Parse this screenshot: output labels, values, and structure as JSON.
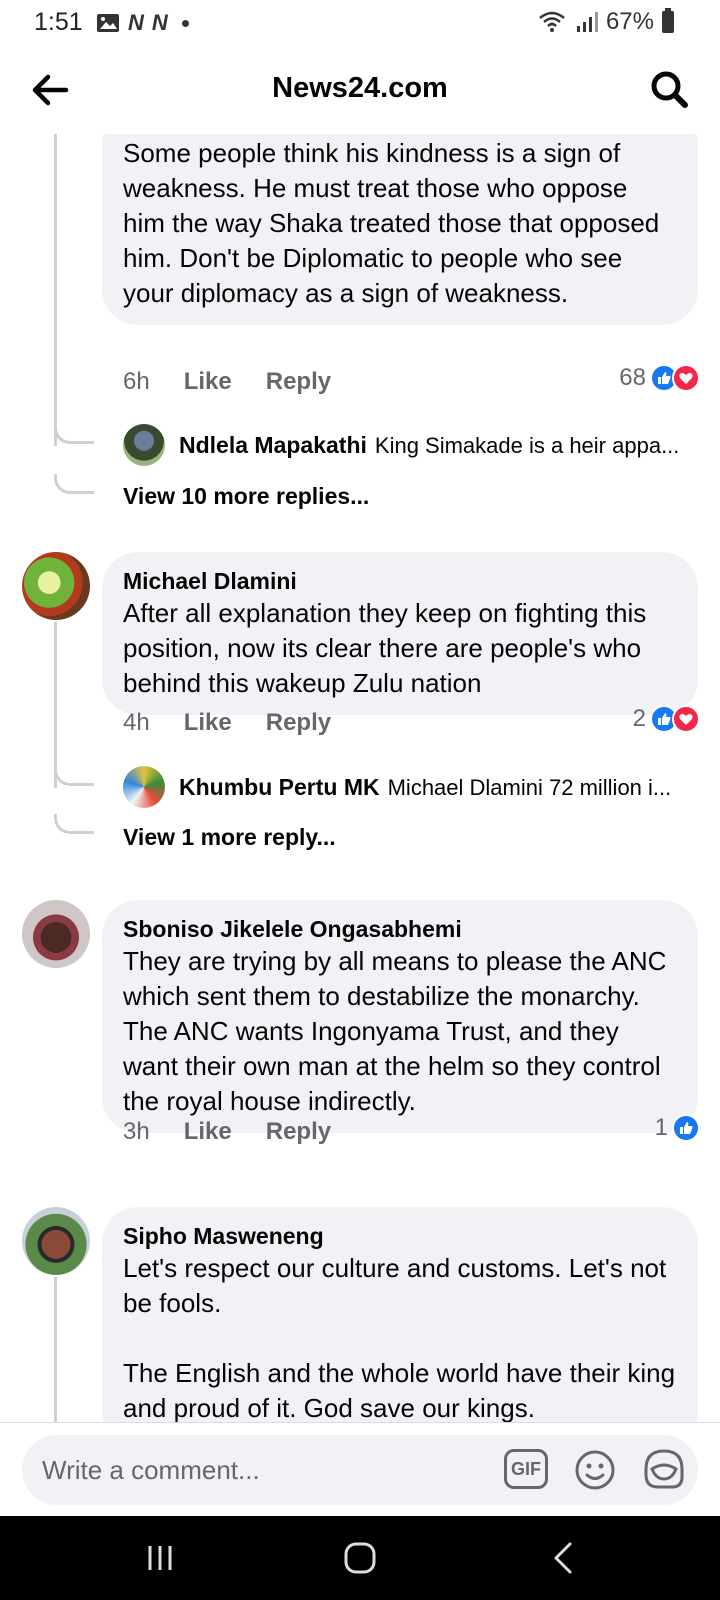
{
  "status_bar": {
    "time": "1:51",
    "battery": "67%",
    "n1": "N",
    "n2": "N"
  },
  "header": {
    "title": "News24.com"
  },
  "comments": [
    {
      "text": "Some people think his kindness is a sign of weakness. He must treat those who oppose him the way Shaka treated those that opposed him. Don't be Diplomatic to people who see your diplomacy as a sign of weakness.",
      "time": "6h",
      "like": "Like",
      "reply": "Reply",
      "reactions": "68",
      "reply_preview": {
        "name": "Ndlela Mapakathi",
        "text": "King Simakade is a heir appa..."
      },
      "view_more": "View 10 more replies..."
    },
    {
      "author": "Michael Dlamini",
      "text": "After all explanation they keep on fighting this position, now its clear there are people's who behind this wakeup Zulu nation",
      "time": "4h",
      "like": "Like",
      "reply": "Reply",
      "reactions": "2",
      "reply_preview": {
        "name": "Khumbu Pertu MK",
        "text": "Michael Dlamini 72 million i..."
      },
      "view_more": "View 1 more reply..."
    },
    {
      "author": "Sboniso Jikelele Ongasabhemi",
      "text": "They are trying by all means to please the ANC which sent them to destabilize the monarchy. The ANC wants Ingonyama Trust, and they want their own man at the helm so they control the royal house indirectly.",
      "time": "3h",
      "like": "Like",
      "reply": "Reply",
      "reactions": "1"
    },
    {
      "author": "Sipho Masweneng",
      "text": "Let's respect our culture and customs. Let's not be fools.\n\nThe English and the whole world have their king and proud of it. God save our kings."
    }
  ],
  "composer": {
    "placeholder": "Write a comment...",
    "gif": "GIF"
  },
  "colors": {
    "like_blue": "#1877f2",
    "love_red": "#f02849",
    "bubble_gray": "#f0f2f5",
    "meta_gray": "#65676b"
  }
}
